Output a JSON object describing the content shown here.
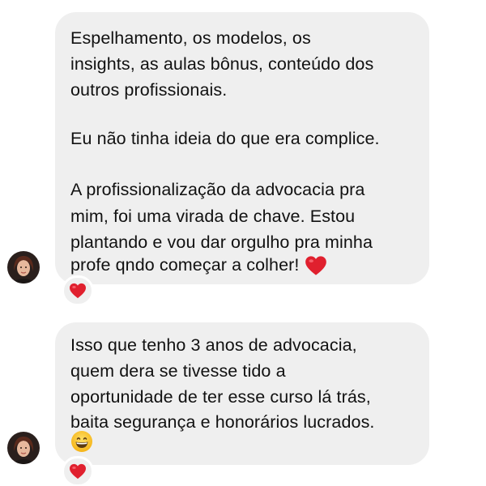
{
  "messages": [
    {
      "lines": [
        "Espelhamento,  os modelos, os",
        "insights, as aulas bônus,  conteúdo dos",
        "outros profissionais.",
        "Eu não tinha ideia do que era complice.",
        "A profissionalização da advocacia pra",
        "mim, foi uma virada de chave. Estou",
        "plantando e vou dar orgulho pra minha",
        "profe qndo começar a colher!"
      ],
      "trailing_emoji": "red-heart-emoji",
      "reaction": "red-heart-emoji"
    },
    {
      "lines": [
        "Isso que tenho 3 anos de advocacia,",
        "quem dera se tivesse tido a",
        "oportunidade de ter esse curso lá trás,",
        "baita segurança e honorários lucrados."
      ],
      "trailing_emoji": "grinning-face-emoji",
      "reaction": "red-heart-emoji"
    }
  ],
  "colors": {
    "bubble_background": "#efefef",
    "text": "#111111",
    "heart": "#e0202e",
    "page_background": "#ffffff"
  }
}
